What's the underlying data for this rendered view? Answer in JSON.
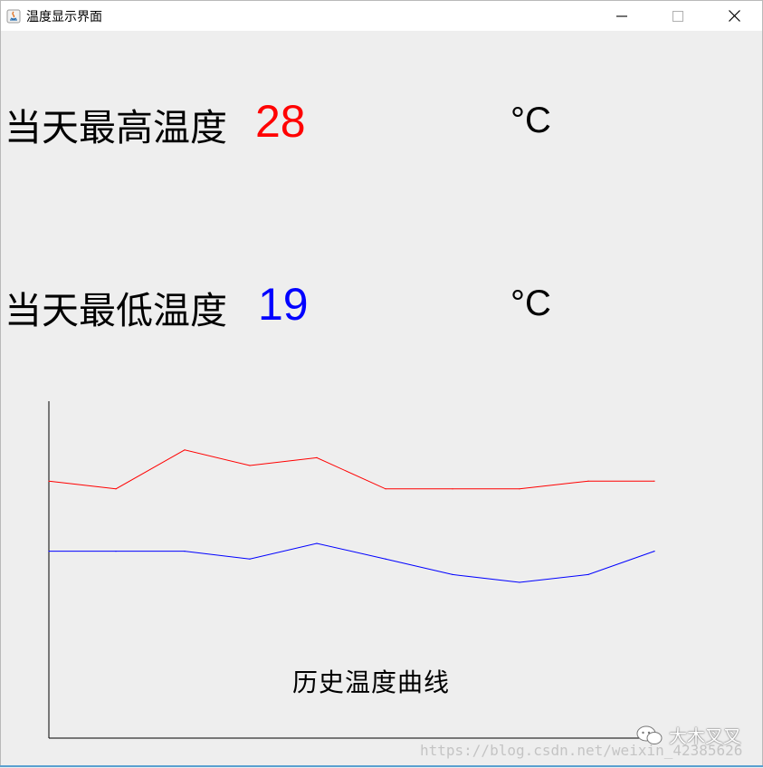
{
  "window": {
    "title": "温度显示界面",
    "minimize_glyph": "—",
    "maximize_glyph": "☐",
    "close_glyph": "✕"
  },
  "high": {
    "label": "当天最高温度",
    "value": "28",
    "unit": "°C",
    "color": "#ff0000"
  },
  "low": {
    "label": "当天最低温度",
    "value": "19",
    "unit": "°C",
    "color": "#0000ff"
  },
  "chart_data": {
    "type": "line",
    "title": "历史温度曲线",
    "x": [
      1,
      2,
      3,
      4,
      5,
      6,
      7,
      8,
      9,
      10
    ],
    "series": [
      {
        "values": [
          28,
          27,
          32,
          30,
          31,
          27,
          27,
          27,
          28,
          28
        ],
        "color": "#ff0000"
      },
      {
        "values": [
          19,
          19,
          19,
          18,
          20,
          18,
          16,
          15,
          16,
          19
        ],
        "color": "#0000ff"
      }
    ],
    "ylim": [
      -5,
      38
    ],
    "grid": false
  },
  "watermark": {
    "url": "https://blog.csdn.net/weixin_42385626",
    "brand": "大木叉叉",
    "icon": "wechat-icon"
  }
}
